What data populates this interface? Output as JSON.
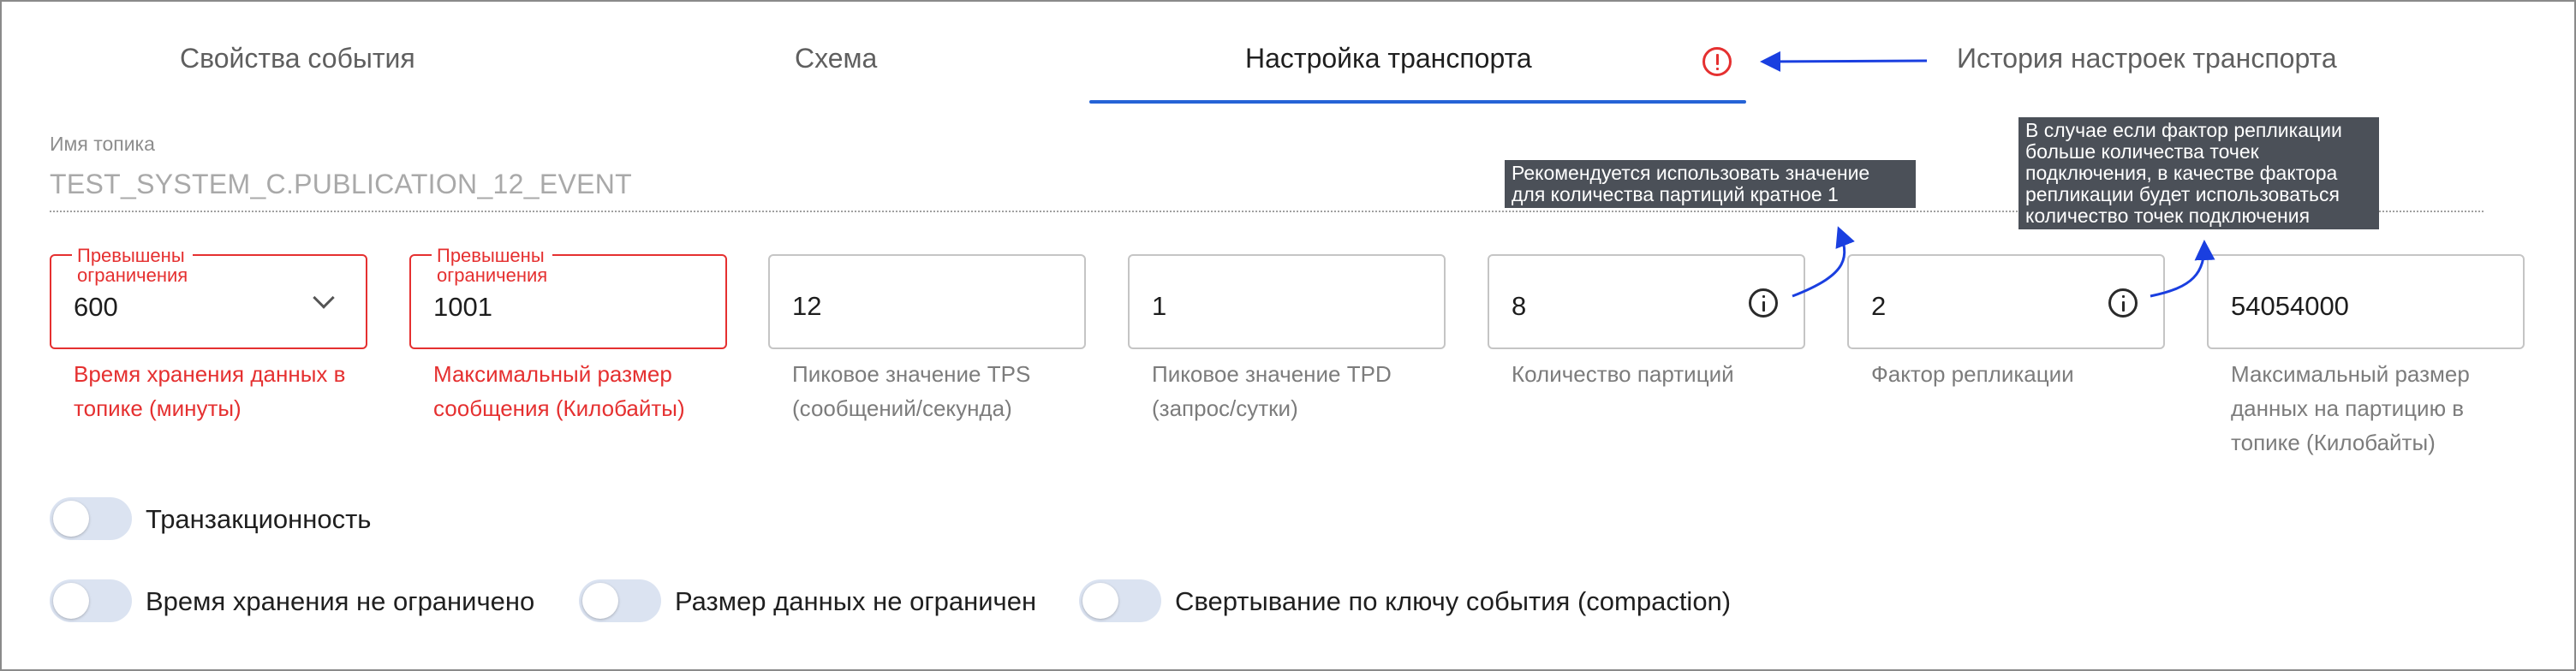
{
  "tabs": [
    {
      "label": "Свойства события",
      "active": false
    },
    {
      "label": "Схема",
      "active": false
    },
    {
      "label": "Настройка транспорта",
      "active": true
    },
    {
      "label": "История настроек транспорта",
      "active": false
    }
  ],
  "topic": {
    "label": "Имя топика",
    "value": "TEST_SYSTEM_C.PUBLICATION_12_EVENT"
  },
  "fields": [
    {
      "legend": "Превышены\nограничения",
      "value": "600",
      "help": "Время хранения данных в топике (минуты)",
      "error": true,
      "icon": "chevron-down-icon"
    },
    {
      "legend": "Превышены\nограничения",
      "value": "1001",
      "help": "Максимальный размер сообщения (Килобайты)",
      "error": true
    },
    {
      "value": "12",
      "help": "Пиковое значение TPS (сообщений/секунда)",
      "error": false
    },
    {
      "value": "1",
      "help": "Пиковое значение TPD (запрос/сутки)",
      "error": false
    },
    {
      "value": "8",
      "help": "Количество партиций",
      "error": false,
      "icon": "info-icon"
    },
    {
      "value": "2",
      "help": "Фактор репликации",
      "error": false,
      "icon": "info-icon"
    },
    {
      "value": "54054000",
      "help": "Максимальный размер данных на партицию в топике (Килобайты)",
      "error": false
    }
  ],
  "tooltips": {
    "partitions": "Рекомендуется использовать значение\nдля количества партиций кратное 1",
    "replication": "В случае если фактор репликации\nбольше количества точек\nподключения, в качестве фактора\nрепликации будет использоваться\nколичество точек подключения"
  },
  "toggles": [
    {
      "label": "Транзакционность",
      "on": false
    },
    {
      "label": "Время хранения не ограничено",
      "on": false
    },
    {
      "label": "Размер данных не ограничен",
      "on": false
    },
    {
      "label": "Свертывание по ключу события (compaction)",
      "on": false
    }
  ],
  "colors": {
    "accent": "#2563d6",
    "error": "#e53030",
    "annotation_arrow": "#1a3fe0",
    "tooltip_bg": "#4b5058",
    "toggle_track": "#dbe3f1"
  },
  "icons": [
    "warning-icon",
    "chevron-down-icon",
    "info-icon"
  ]
}
